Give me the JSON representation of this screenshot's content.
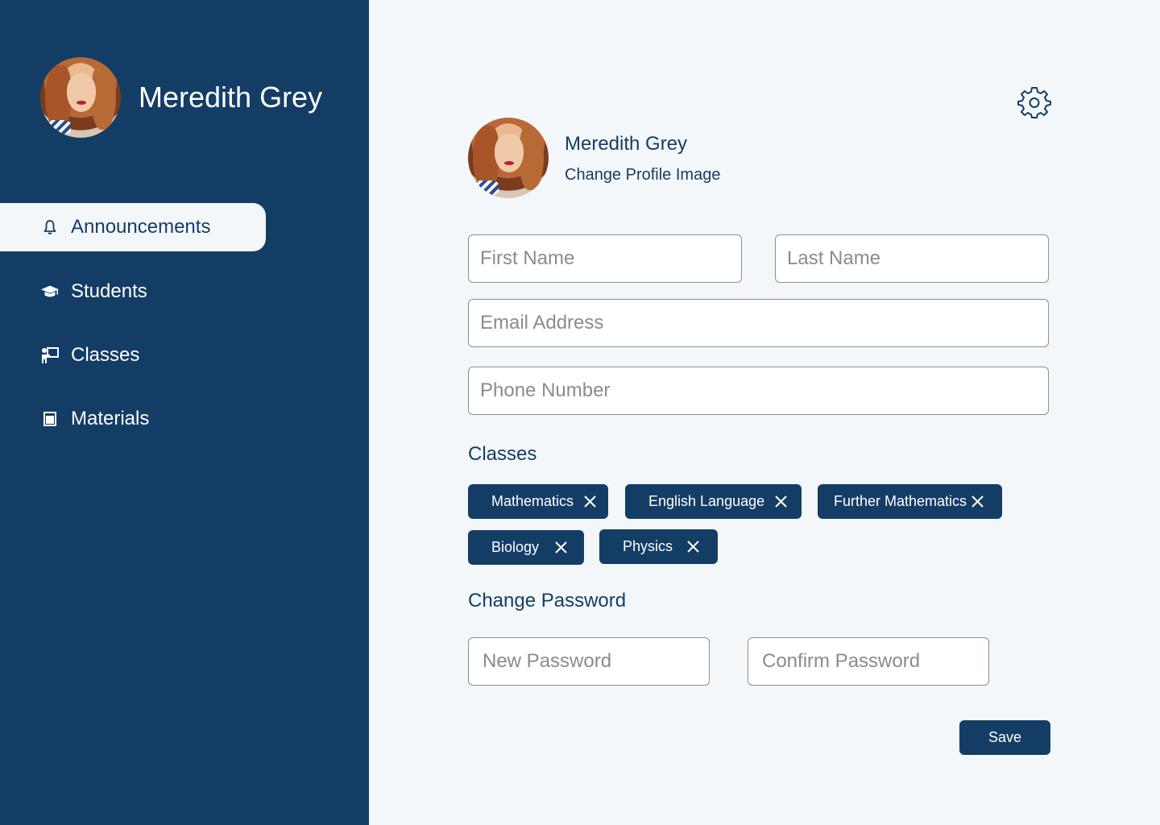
{
  "user": {
    "name": "Meredith Grey"
  },
  "sidebar": {
    "items": [
      {
        "label": "Announcements",
        "icon": "bell-icon",
        "active": true
      },
      {
        "label": "Students",
        "icon": "graduation-cap-icon",
        "active": false
      },
      {
        "label": "Classes",
        "icon": "chalkboard-teacher-icon",
        "active": false
      },
      {
        "label": "Materials",
        "icon": "book-icon",
        "active": false
      }
    ]
  },
  "profile": {
    "name": "Meredith Grey",
    "change_image_label": "Change Profile Image"
  },
  "form": {
    "first_name": {
      "placeholder": "First Name",
      "value": ""
    },
    "last_name": {
      "placeholder": "Last Name",
      "value": ""
    },
    "email": {
      "placeholder": "Email Address",
      "value": ""
    },
    "phone": {
      "placeholder": "Phone Number",
      "value": ""
    }
  },
  "classes": {
    "title": "Classes",
    "chips": [
      "Mathematics",
      "English Language",
      "Further Mathematics",
      "Biology",
      "Physics"
    ]
  },
  "password": {
    "title": "Change Password",
    "new_placeholder": "New Password",
    "confirm_placeholder": "Confirm Password"
  },
  "actions": {
    "save_label": "Save"
  },
  "colors": {
    "sidebar_bg": "#143d66",
    "page_bg": "#f3f7fa",
    "accent": "#143d66"
  }
}
